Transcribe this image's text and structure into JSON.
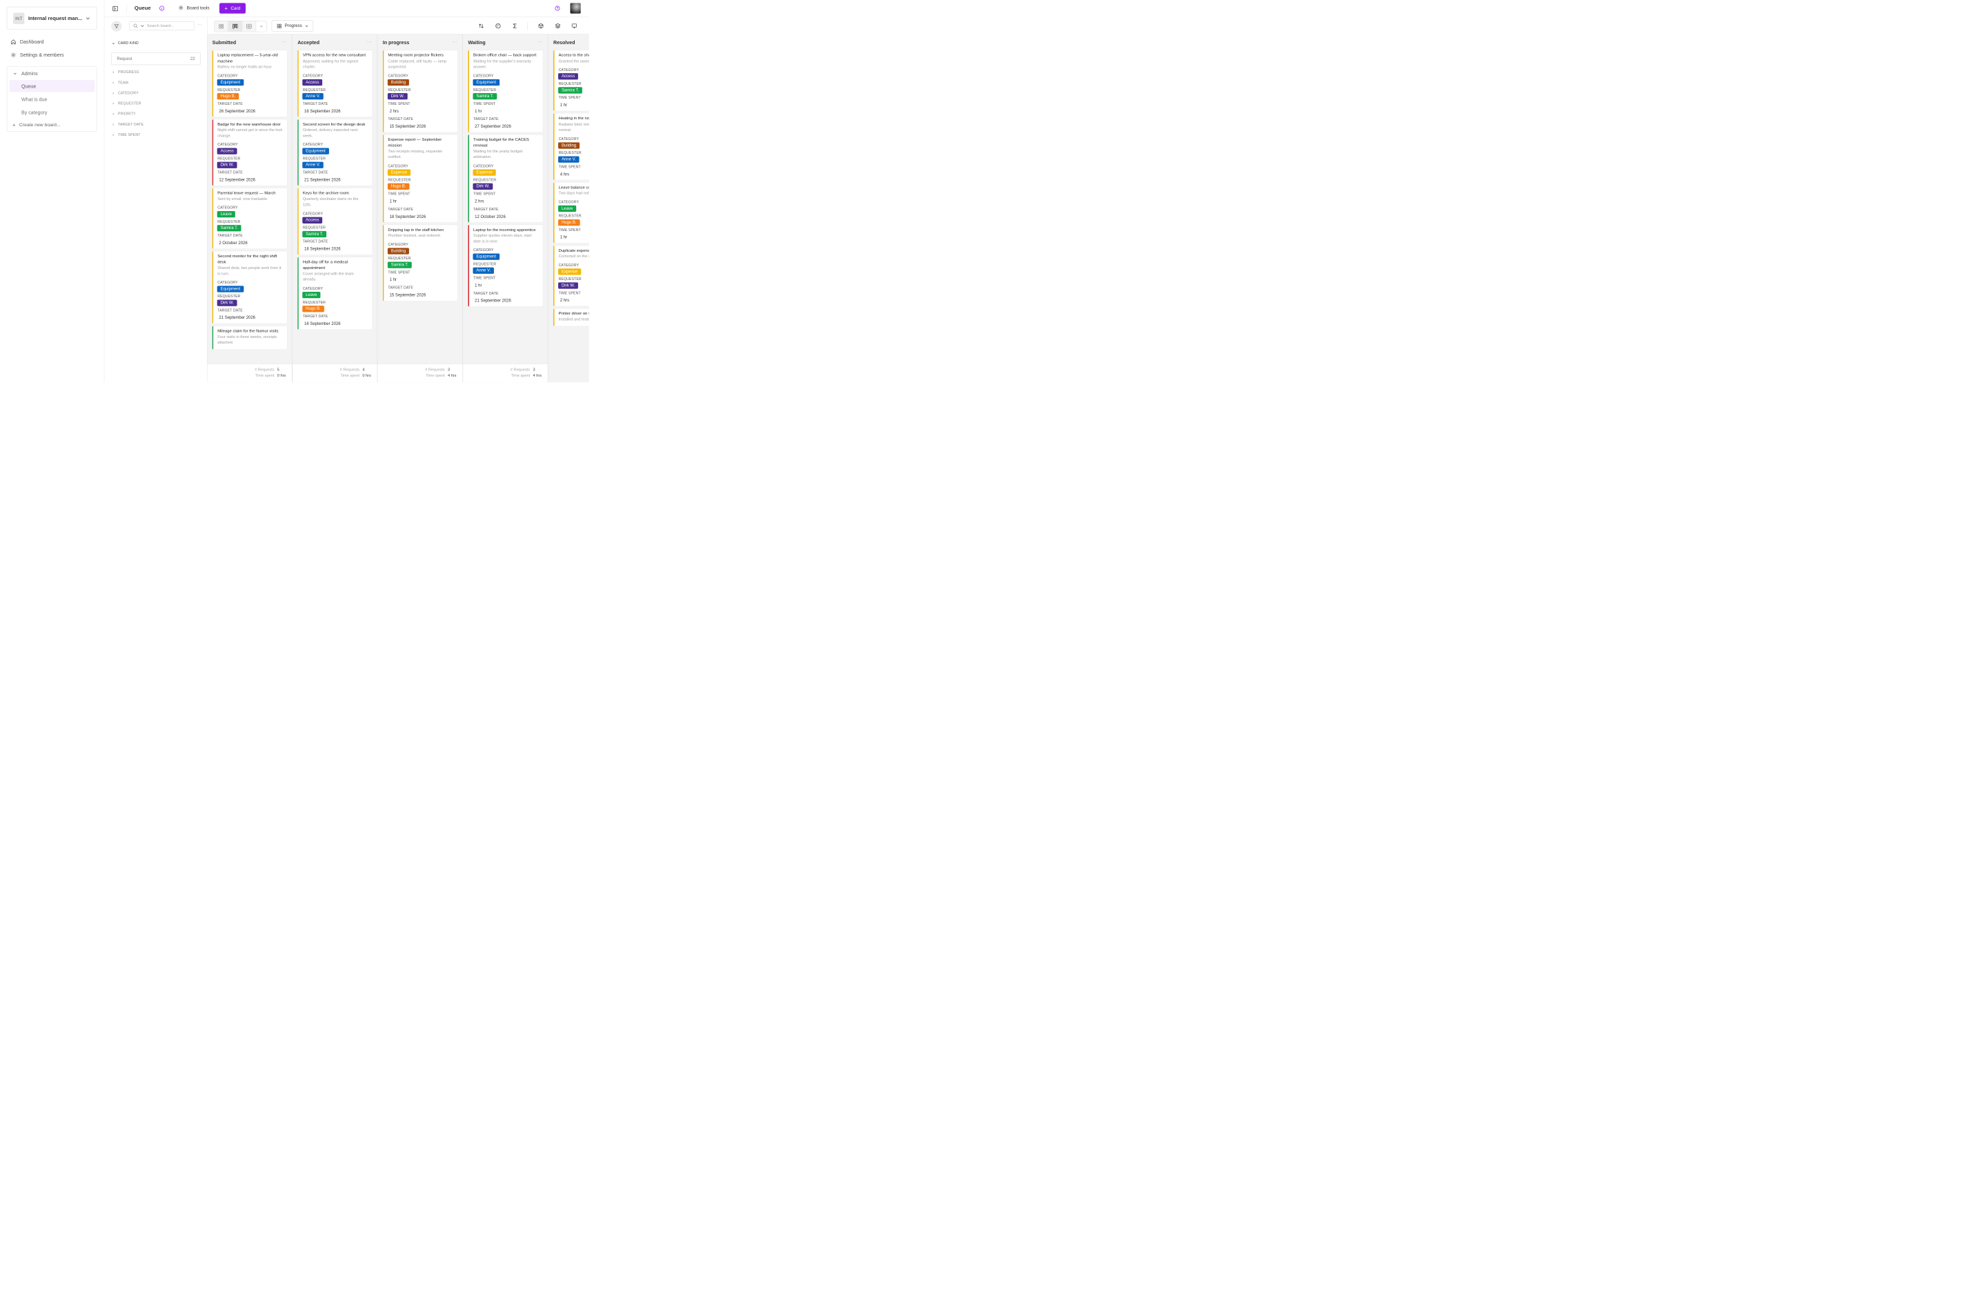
{
  "app": {
    "workspace_badge": "INT",
    "workspace_name": "Internal request man..."
  },
  "sidebar": {
    "dashboard": "Dashboard",
    "settings": "Settings & members",
    "group": "Admins",
    "items": [
      "Queue",
      "What is due",
      "By category"
    ],
    "create": "Create new board..."
  },
  "topbar": {
    "title": "Queue",
    "board_tools": "Board tools",
    "card_button": "Card"
  },
  "filters": {
    "search_placeholder": "Search board...",
    "section": "CARD KIND",
    "kind_label": "Request",
    "kind_count": "22",
    "groups": [
      "PROGRESS",
      "TEAM",
      "CATEGORY",
      "REQUESTER",
      "PRIORITY",
      "TARGET DATE",
      "TIME SPENT"
    ]
  },
  "toolbar": {
    "group_by": "Progress"
  },
  "labels": {
    "category": "CATEGORY",
    "requester": "REQUESTER",
    "target_date": "TARGET DATE",
    "time_spent": "TIME SPENT",
    "requests": "# Requests",
    "time_spent_foot": "Time spent"
  },
  "colors": {
    "accent": "#8b1ee6",
    "blue": "#0a66c2",
    "purple": "#4a2f91",
    "orange": "#f57f17",
    "green": "#14a84c",
    "brown": "#a24a0f",
    "yellow": "#f5b800",
    "priority_high": "#d8262d",
    "priority_medium": "#f5b800",
    "priority_low": "#17a34a"
  },
  "columns": [
    {
      "name": "Submitted",
      "requests": "5",
      "time_spent": "0 hrs",
      "cards": [
        {
          "title": "Laptop replacement — 5-year-old machine",
          "desc": "Battery no longer holds an hour.",
          "accent": "yellow",
          "category": "Equipment",
          "requester": "Hugo B.",
          "target_date": "26 September 2026"
        },
        {
          "title": "Badge for the new warehouse door",
          "desc": "Night shift cannot get in since the lock change.",
          "accent": "red",
          "category": "Access",
          "requester": "Dirk W.",
          "target_date": "12 September 2026"
        },
        {
          "title": "Parental leave request — March",
          "desc": "Sent by email, now trackable.",
          "accent": "yellow",
          "category": "Leave",
          "requester": "Samira T.",
          "target_date": "2 October 2026"
        },
        {
          "title": "Second monitor for the night shift desk",
          "desc": "Shared desk, two people work from it in turn.",
          "accent": "yellow",
          "category": "Equipment",
          "requester": "Dirk W.",
          "target_date": "21 September 2026"
        },
        {
          "title": "Mileage claim for the Namur visits",
          "desc": "Four visits in three weeks, receipts attached.",
          "accent": "green"
        }
      ]
    },
    {
      "name": "Accepted",
      "requests": "4",
      "time_spent": "0 hrs",
      "cards": [
        {
          "title": "VPN access for the new consultant",
          "desc": "Approved, waiting for the signed charter.",
          "accent": "yellow",
          "category": "Access",
          "requester": "Anne V.",
          "target_date": "16 September 2026"
        },
        {
          "title": "Second screen for the design desk",
          "desc": "Ordered, delivery expected next week.",
          "accent": "green",
          "category": "Equipment",
          "requester": "Anne V.",
          "target_date": "21 September 2026"
        },
        {
          "title": "Keys for the archive room",
          "desc": "Quarterly stocktake starts on the 12th.",
          "accent": "yellow",
          "category": "Access",
          "requester": "Samira T.",
          "target_date": "18 September 2026"
        },
        {
          "title": "Half-day off for a medical appointment",
          "desc": "Cover arranged with the team already.",
          "accent": "green",
          "category": "Leave",
          "requester": "Hugo B.",
          "target_date": "16 September 2026"
        }
      ]
    },
    {
      "name": "In progress",
      "requests": "3",
      "time_spent": "4 hrs",
      "cards": [
        {
          "title": "Meeting room projector flickers",
          "desc": "Cable replaced, still faulty — lamp suspected.",
          "accent": "yellow",
          "category": "Building",
          "requester": "Dirk W.",
          "time_spent": "2 hrs",
          "target_date": "15 September 2026"
        },
        {
          "title": "Expense report — September mission",
          "desc": "Two receipts missing, requester notified.",
          "accent": "yellow",
          "category": "Expense",
          "requester": "Hugo B.",
          "time_spent": "1 hr",
          "target_date": "18 September 2026"
        },
        {
          "title": "Dripping tap in the staff kitchen",
          "desc": "Plumber booked, seal ordered.",
          "accent": "yellow",
          "category": "Building",
          "requester": "Samira T.",
          "time_spent": "1 hr",
          "target_date": "15 September 2026"
        }
      ]
    },
    {
      "name": "Waiting",
      "requests": "3",
      "time_spent": "4 hrs",
      "cards": [
        {
          "title": "Broken office chair — back support",
          "desc": "Waiting for the supplier's warranty answer.",
          "accent": "yellow",
          "category": "Equipment",
          "requester": "Samira T.",
          "time_spent": "1 hr",
          "target_date": "27 September 2026"
        },
        {
          "title": "Training budget for the CACES renewal",
          "desc": "Waiting for the yearly budget arbitration.",
          "accent": "green",
          "category": "Expense",
          "requester": "Dirk W.",
          "time_spent": "2 hrs",
          "target_date": "12 October 2026"
        },
        {
          "title": "Laptop for the incoming apprentice",
          "desc": "Supplier quotes eleven days; start date is in nine.",
          "accent": "red",
          "category": "Equipment",
          "requester": "Anne V.",
          "time_spent": "1 hr",
          "target_date": "21 September 2026"
        }
      ]
    },
    {
      "name": "Resolved",
      "cards": [
        {
          "title": "Access to the shared folder",
          "desc": "Granted the same day.",
          "accent": "yellow",
          "category": "Access",
          "requester": "Samira T.",
          "time_spent": "1 hr"
        },
        {
          "title": "Heating in the north office",
          "desc": "Radiator bled, temperature back to normal.",
          "accent": "yellow",
          "category": "Building",
          "requester": "Anne V.",
          "time_spent": "4 hrs"
        },
        {
          "title": "Leave balance correction",
          "desc": "Two days had not been carried over.",
          "accent": "yellow",
          "category": "Leave",
          "requester": "Hugo B.",
          "time_spent": "1 hr"
        },
        {
          "title": "Duplicate expense reimbursement",
          "desc": "Corrected on the next payslip.",
          "accent": "yellow",
          "category": "Expense",
          "requester": "Dirk W.",
          "time_spent": "2 hrs"
        },
        {
          "title": "Printer driver on the PCs",
          "desc": "Installed and tested on all machines.",
          "accent": "yellow"
        }
      ]
    }
  ]
}
